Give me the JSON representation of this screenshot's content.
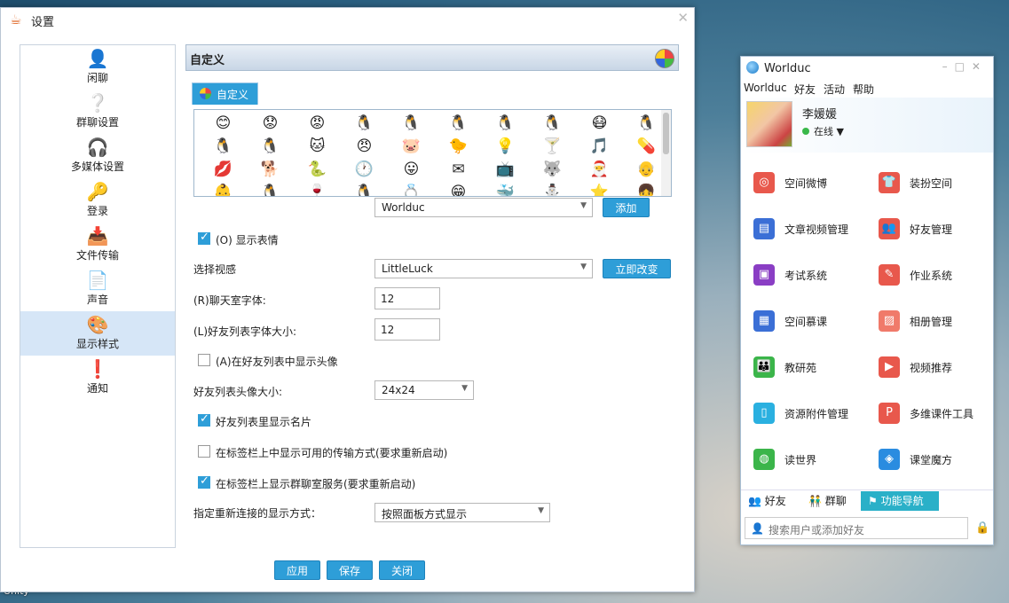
{
  "desktop": {
    "bottom_label": "Unity"
  },
  "settings": {
    "title": "设置",
    "nav": [
      {
        "icon": "chat-person-icon",
        "label": "闲聊"
      },
      {
        "icon": "group-question-icon",
        "label": "群聊设置"
      },
      {
        "icon": "headphones-icon",
        "label": "多媒体设置"
      },
      {
        "icon": "key-icon",
        "label": "登录"
      },
      {
        "icon": "file-transfer-icon",
        "label": "文件传输"
      },
      {
        "icon": "sound-icon",
        "label": "声音"
      },
      {
        "icon": "palette-icon",
        "label": "显示样式"
      },
      {
        "icon": "notice-icon",
        "label": "通知"
      }
    ],
    "active_nav": "显示样式",
    "header": "自定义",
    "tab": "自定义",
    "emoticon_select": "Worlduc",
    "add_button": "添加",
    "show_emoticons": {
      "label": "(O) 显示表情",
      "checked": true
    },
    "visual_label": "选择视感",
    "visual_select": "LittleLuck",
    "apply_visual_button": "立即改变",
    "chat_font_label": "(R)聊天室字体:",
    "chat_font_value": "12",
    "friend_font_label": "(L)好友列表字体大小:",
    "friend_font_value": "12",
    "show_avatar": {
      "label": "(A)在好友列表中显示头像",
      "checked": false
    },
    "avatar_size_label": "好友列表头像大小:",
    "avatar_size_value": "24x24",
    "show_card": {
      "label": "好友列表里显示名片",
      "checked": true
    },
    "show_transfer": {
      "label": "在标签栏上中显示可用的传输方式(要求重新启动)",
      "checked": false
    },
    "show_group_service": {
      "label": "在标签栏上显示群聊室服务(要求重新启动)",
      "checked": true
    },
    "reconnect_label": "指定重新连接的显示方式：",
    "reconnect_value": "按照面板方式显示",
    "buttons": {
      "apply": "应用",
      "save": "保存",
      "close": "关闭"
    }
  },
  "worlduc": {
    "title": "Worlduc",
    "menu": [
      "Worlduc",
      "好友",
      "活动",
      "帮助"
    ],
    "user": {
      "name": "李媛媛",
      "status": "在线"
    },
    "features": [
      {
        "label": "空间微博",
        "icon": "weibo-icon",
        "color": "#e8584c"
      },
      {
        "label": "装扮空间",
        "icon": "shirt-icon",
        "color": "#e8584c"
      },
      {
        "label": "文章视频管理",
        "icon": "document-icon",
        "color": "#3b6fd6"
      },
      {
        "label": "好友管理",
        "icon": "friends-icon",
        "color": "#e8584c"
      },
      {
        "label": "考试系统",
        "icon": "monitor-icon",
        "color": "#8a3ec4"
      },
      {
        "label": "作业系统",
        "icon": "homework-icon",
        "color": "#e8584c"
      },
      {
        "label": "空间慕课",
        "icon": "mooc-icon",
        "color": "#3b6fd6"
      },
      {
        "label": "相册管理",
        "icon": "album-icon",
        "color": "#f07a6a"
      },
      {
        "label": "教研苑",
        "icon": "research-icon",
        "color": "#3bb54a"
      },
      {
        "label": "视频推荐",
        "icon": "video-icon",
        "color": "#e8584c"
      },
      {
        "label": "资源附件管理",
        "icon": "attachment-icon",
        "color": "#2ab0e0"
      },
      {
        "label": "多维课件工具",
        "icon": "ppt-icon",
        "color": "#e8584c"
      },
      {
        "label": "读世界",
        "icon": "globe-icon",
        "color": "#3bb54a"
      },
      {
        "label": "课堂魔方",
        "icon": "cube-icon",
        "color": "#2a8ce0"
      }
    ],
    "tabs": [
      "好友",
      "群聊",
      "功能导航"
    ],
    "active_tab": "功能导航",
    "search_placeholder": "搜索用户或添加好友"
  }
}
